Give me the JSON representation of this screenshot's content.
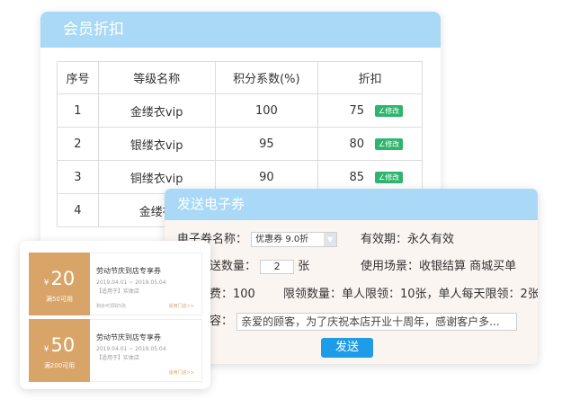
{
  "member_panel": {
    "title": "会员折扣",
    "columns": [
      "序号",
      "等级名称",
      "积分系数(%)",
      "折扣"
    ],
    "edit_label": "∠修改",
    "rows": [
      {
        "no": "1",
        "name": "金缕衣vip",
        "coef": "100",
        "discount": "75"
      },
      {
        "no": "2",
        "name": "银缕衣vip",
        "coef": "95",
        "discount": "80"
      },
      {
        "no": "3",
        "name": "铜缕衣vip",
        "coef": "90",
        "discount": "85"
      },
      {
        "no": "4",
        "name": "金缕衣",
        "coef": "",
        "discount": ""
      }
    ]
  },
  "send_panel": {
    "title": "发送电子券",
    "coupon_name_label": "电子券名称：",
    "coupon_name_value": "优惠券 9.0折",
    "validity_label": "有效期：",
    "validity_value": "永久有效",
    "quantity_label": "送数量：",
    "quantity_value": "2",
    "quantity_unit": "张",
    "scene_label": "使用场景：",
    "scene_value": "收银结算 商城买单",
    "fee_label": "费：",
    "fee_value": "100",
    "limit_label": "限领数量：",
    "limit_value": "单人限领：10张，单人每天限领：2张",
    "content_label": "容：",
    "content_value": "亲爱的顾客，为了庆祝本店开业十周年，感谢客户多...",
    "send_label": "发送"
  },
  "coupons": [
    {
      "amount": "20",
      "currency": "¥",
      "condition": "满50可用",
      "title": "劳动节庆到店专享券",
      "dates": "2019.04.01 ~ 2019.05.04",
      "scope": "【适用于】实体店",
      "note": "剩余可领取5张",
      "store": "适用门店>>"
    },
    {
      "amount": "50",
      "currency": "¥",
      "condition": "满200可用",
      "title": "劳动节庆到店专享券",
      "dates": "2019.04.01 ~ 2019.05.04",
      "scope": "【适用于】实体店",
      "note": "",
      "store": "适用门店>>"
    }
  ]
}
